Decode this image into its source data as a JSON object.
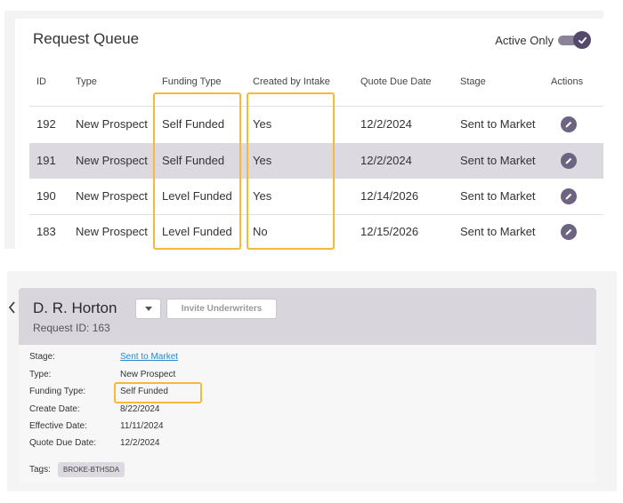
{
  "queue": {
    "title": "Request Queue",
    "active_only_label": "Active Only",
    "active_only_on": true,
    "columns": [
      "ID",
      "Type",
      "Funding Type",
      "Created by Intake",
      "Quote Due Date",
      "Stage",
      "Actions"
    ],
    "rows": [
      {
        "id": "192",
        "type": "New Prospect",
        "funding": "Self Funded",
        "intake": "Yes",
        "due": "12/2/2024",
        "stage": "Sent to Market"
      },
      {
        "id": "191",
        "type": "New Prospect",
        "funding": "Self Funded",
        "intake": "Yes",
        "due": "12/2/2024",
        "stage": "Sent to Market"
      },
      {
        "id": "190",
        "type": "New Prospect",
        "funding": "Level Funded",
        "intake": "Yes",
        "due": "12/14/2026",
        "stage": "Sent to Market"
      },
      {
        "id": "183",
        "type": "New Prospect",
        "funding": "Level Funded",
        "intake": "No",
        "due": "12/15/2026",
        "stage": "Sent to Market"
      }
    ]
  },
  "detail": {
    "company": "D. R. Horton",
    "request_id": "Request ID: 163",
    "invite_label": "Invite Underwriters",
    "fields": [
      {
        "label": "Stage:",
        "value": "Sent to Market"
      },
      {
        "label": "Type:",
        "value": "New Prospect"
      },
      {
        "label": "Funding Type:",
        "value": "Self Funded"
      },
      {
        "label": "Create Date:",
        "value": "8/22/2024"
      },
      {
        "label": "Effective Date:",
        "value": "11/11/2024"
      },
      {
        "label": "Quote Due Date:",
        "value": "12/2/2024"
      }
    ],
    "tags_label": "Tags:",
    "tag": "BROKE-BTHSDA"
  },
  "colors": {
    "accent": "#534a6b",
    "highlight": "#f7b93a",
    "link": "#2f86c7",
    "row_shade": "#dcdae0"
  },
  "icons": [
    "check-icon",
    "pencil-icon",
    "caret-down-icon",
    "chevron-left-icon"
  ]
}
